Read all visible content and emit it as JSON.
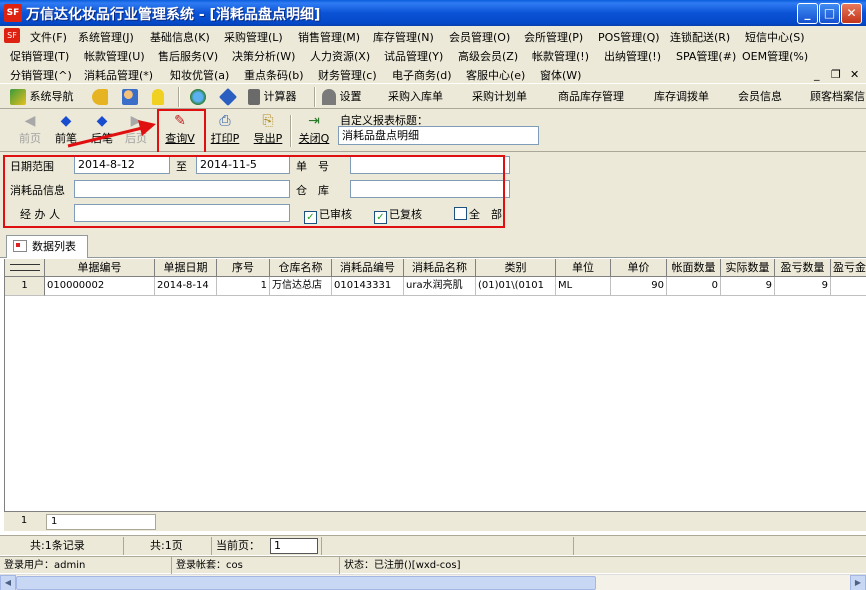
{
  "window": {
    "title": "万信达化妆品行业管理系统 - [消耗品盘点明细]",
    "app_icon": "SF",
    "controls": {
      "minimize": "_",
      "maximize": "□",
      "close": "✕"
    }
  },
  "menu": {
    "row1": [
      "文件(F)",
      "系统管理(J)",
      "基础信息(K)",
      "采购管理(L)",
      "销售管理(M)",
      "库存管理(N)",
      "会员管理(O)",
      "会所管理(P)",
      "POS管理(Q)",
      "连锁配送(R)",
      "短信中心(S)"
    ],
    "row2": [
      "促销管理(T)",
      "帐款管理(U)",
      "售后服务(V)",
      "决策分析(W)",
      "人力资源(X)",
      "试品管理(Y)",
      "高级会员(Z)",
      "帐款管理(!)",
      "出纳管理(!)",
      "SPA管理(#)",
      "OEM管理(%)"
    ],
    "row3": [
      "分销管理(^)",
      "消耗品管理(*)",
      "知妆优管(a)",
      "重点条码(b)",
      "财务管理(c)",
      "电子商务(d)",
      "客服中心(e)",
      "窗体(W)"
    ],
    "mdi": {
      "minimize": "_",
      "restore": "❐",
      "close": "✕"
    }
  },
  "toolbar1": {
    "nav": "系统导航",
    "calc": "计算器",
    "settings": "设置",
    "items": [
      "采购入库单",
      "采购计划单",
      "商品库存管理",
      "库存调拨单",
      "会员信息",
      "顾客档案信"
    ]
  },
  "toolbar2": {
    "buttons": [
      {
        "label": "前页",
        "enabled": false
      },
      {
        "label": "前笔",
        "enabled": true
      },
      {
        "label": "后笔",
        "enabled": true
      },
      {
        "label": "后页",
        "enabled": false
      },
      {
        "label": "查询V",
        "enabled": true
      },
      {
        "label": "打印P",
        "enabled": true
      },
      {
        "label": "导出P",
        "enabled": true
      },
      {
        "label": "关闭Q",
        "enabled": true
      }
    ],
    "custom_title_label": "自定义报表标题：",
    "custom_title_value": "消耗品盘点明细"
  },
  "filter": {
    "date_label": "日期范围",
    "date_from": "2014-8-12",
    "to_label": "至",
    "date_to": "2014-11-5",
    "order_label": "单　号",
    "order_value": "",
    "item_label": "消耗品信息",
    "item_value": "",
    "warehouse_label": "仓　库",
    "warehouse_value": "",
    "handler_label": "经 办 人",
    "handler_value": "",
    "checks": [
      {
        "label": "已审核",
        "checked": true
      },
      {
        "label": "已复核",
        "checked": true
      },
      {
        "label": "全　部",
        "checked": false
      }
    ]
  },
  "tab": {
    "label": "数据列表"
  },
  "grid": {
    "columns": [
      "单据编号",
      "单据日期",
      "序号",
      "仓库名称",
      "消耗品编号",
      "消耗品名称",
      "类别",
      "单位",
      "单价",
      "帐面数量",
      "实际数量",
      "盈亏数量",
      "盈亏金"
    ],
    "rows": [
      {
        "n": "1",
        "cells": [
          "010000002",
          "2014-8-14",
          "1",
          "万信达总店",
          "010143331",
          "ura水润亮肌",
          "(01)01\\(0101",
          "ML",
          "90",
          "0",
          "9",
          "9",
          ""
        ]
      }
    ]
  },
  "footer": {
    "row_no": "1",
    "value": "1"
  },
  "status": {
    "records": "共:1条记录",
    "pages": "共:1页",
    "current_page_label": "当前页：",
    "current_page": "1",
    "user": "登录用户：admin",
    "account": "登录帐套：cos",
    "state": "状态：已注册()[wxd-cos]"
  }
}
